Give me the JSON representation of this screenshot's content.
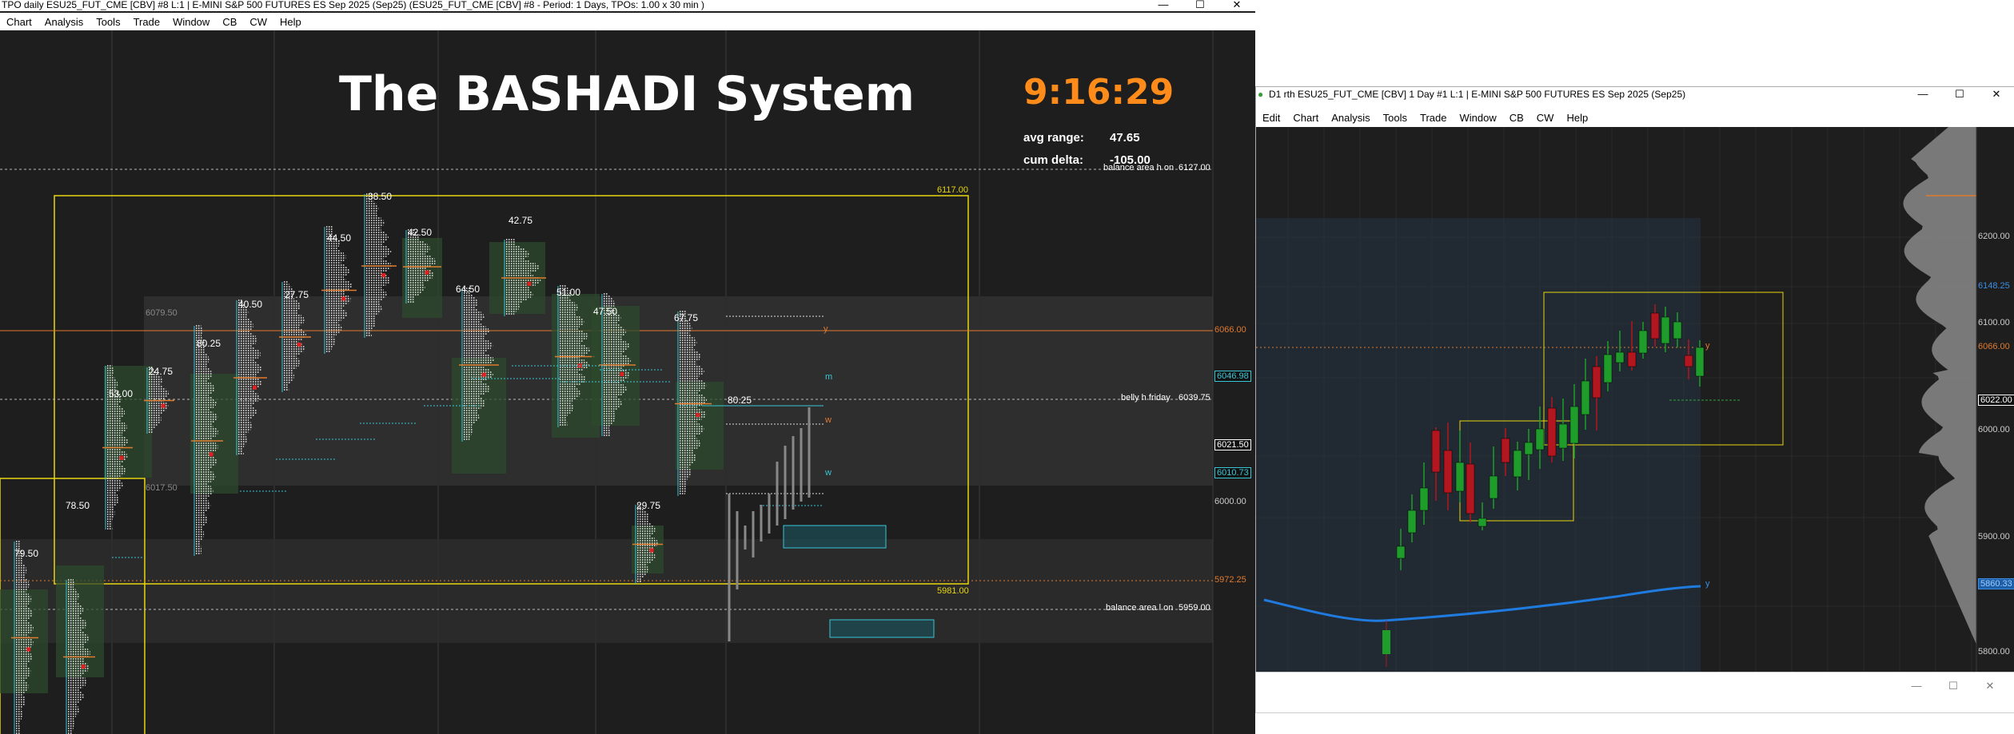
{
  "left_window": {
    "title": "TPO daily ESU25_FUT_CME [CBV] #8 L:1 | E-MINI S&P 500 FUTURES ES Sep 2025 (Sep25) (ESU25_FUT_CME [CBV] #8 - Period: 1 Days, TPOs: 1.00 x 30 min )",
    "menu": [
      "Chart",
      "Analysis",
      "Tools",
      "Trade",
      "Window",
      "CB",
      "CW",
      "Help"
    ],
    "controls": {
      "minimize": "—",
      "maximize": "☐",
      "close": "✕"
    },
    "system_title": "The BASHADI System",
    "clock": "9:16:29",
    "stats": [
      {
        "label": "avg range:",
        "value": "47.65"
      },
      {
        "label": "cum delta:",
        "value": "-105.00"
      }
    ],
    "line_labels": [
      {
        "text": "balance area h on",
        "value": "6127.00"
      },
      {
        "text": "belly h friday",
        "value": "6039.75"
      },
      {
        "text": "balance area l on",
        "value": "5959.00"
      }
    ],
    "box_labels": {
      "top": "6117.00",
      "bottom": "5981.00"
    },
    "price_axis": [
      {
        "text": "6066.00",
        "color": "#e07b2e",
        "boxed": false
      },
      {
        "text": "6046.98",
        "color": "#39c6d6",
        "boxed": true
      },
      {
        "text": "6021.50",
        "color": "#ffffff",
        "boxed": true
      },
      {
        "text": "6010.73",
        "color": "#39c6d6",
        "boxed": true
      },
      {
        "text": "6000.00",
        "color": "#cccccc",
        "boxed": false
      },
      {
        "text": "5972.25",
        "color": "#e07b2e",
        "boxed": false
      }
    ],
    "profile_labels": [
      "79.50",
      "78.50",
      "53.00",
      "24.75",
      "80.25",
      "40.50",
      "27.75",
      "44.50",
      "38.50",
      "42.50",
      "64.50",
      "42.75",
      "51.00",
      "47.50",
      "67.75",
      "29.75",
      "80.25"
    ],
    "range_labels": [
      "6079.50",
      "6017.50"
    ],
    "level_letters": [
      "y",
      "m",
      "w",
      "w"
    ],
    "icons": [
      "candle-profile-icon"
    ]
  },
  "right_window": {
    "title": "D1 rth ESU25_FUT_CME [CBV]  1 Day  #1 L:1 | E-MINI S&P 500 FUTURES ES Sep 2025 (Sep25)",
    "menu": [
      "Edit",
      "Chart",
      "Analysis",
      "Tools",
      "Trade",
      "Window",
      "CB",
      "CW",
      "Help"
    ],
    "controls": {
      "minimize": "—",
      "maximize": "☐",
      "close": "✕"
    },
    "price_axis": [
      {
        "text": "6200.00",
        "color": "#cccccc",
        "boxed": false
      },
      {
        "text": "6148.25",
        "color": "#3a8ee6",
        "boxed": false
      },
      {
        "text": "6100.00",
        "color": "#cccccc",
        "boxed": false
      },
      {
        "text": "6066.00",
        "color": "#e07b2e",
        "boxed": false
      },
      {
        "text": "6022.00",
        "color": "#ffffff",
        "boxed": true
      },
      {
        "text": "6000.00",
        "color": "#cccccc",
        "boxed": false
      },
      {
        "text": "5900.00",
        "color": "#cccccc",
        "boxed": false
      },
      {
        "text": "5860.33",
        "color": "#3a8ee6",
        "boxed": true
      },
      {
        "text": "5800.00",
        "color": "#cccccc",
        "boxed": false
      }
    ],
    "level_letters": [
      "y",
      "y"
    ]
  },
  "bottom_window": {
    "controls": {
      "minimize": "—",
      "maximize": "☐",
      "close": "✕"
    }
  },
  "colors": {
    "background": "#1e1e1e",
    "up_candle": "#1f9d2b",
    "down_candle": "#b3161f",
    "accent_orange": "#ff8c1a",
    "box_yellow": "#e8d60e",
    "cyan": "#39c6d6",
    "blue_ma": "#1f7be0"
  }
}
